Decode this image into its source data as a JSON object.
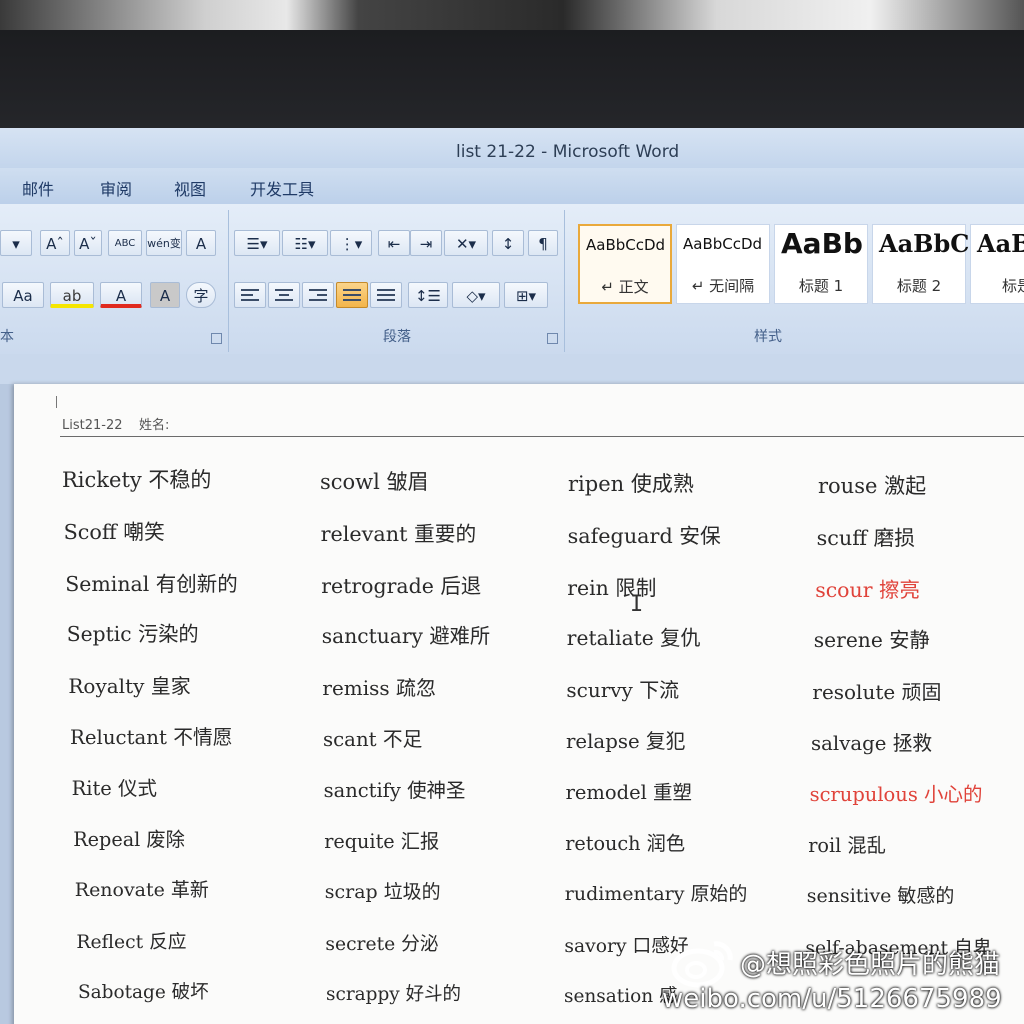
{
  "window": {
    "title": "list 21-22 - Microsoft Word"
  },
  "ribbon_tabs": [
    "邮件",
    "审阅",
    "视图",
    "开发工具"
  ],
  "ribbon": {
    "font_group_label": "本",
    "paragraph_group_label": "段落",
    "styles_group_label": "样式",
    "font_buttons": {
      "grow": "Aˆ",
      "shrink": "Aˇ",
      "clear_format": "ABC",
      "phonetic": "wén变",
      "char_border": "A",
      "change_case": "Aa",
      "highlight": "ab",
      "font_color": "A",
      "char_shading": "A",
      "enclose": "字"
    },
    "styles": [
      {
        "sample": "AaBbCcDd",
        "name": "↵ 正文",
        "selected": true
      },
      {
        "sample": "AaBbCcDd",
        "name": "↵ 无间隔",
        "selected": false
      },
      {
        "sample": "AaBb",
        "name": "标题 1",
        "selected": false
      },
      {
        "sample": "AaBbC",
        "name": "标题 2",
        "selected": false
      },
      {
        "sample": "AaB",
        "name": "标是",
        "selected": false
      }
    ]
  },
  "document": {
    "header": "List21-22    姓名:",
    "columns": [
      [
        "Rickety 不稳的",
        "Scoff 嘲笑",
        "Seminal 有创新的",
        "Septic 污染的",
        "Royalty 皇家",
        "Reluctant 不情愿",
        "Rite 仪式",
        "Repeal 废除",
        "Renovate 革新",
        "Reflect 反应",
        "Sabotage 破坏"
      ],
      [
        "scowl 皱眉",
        "relevant 重要的",
        "retrograde 后退",
        "sanctuary 避难所",
        "remiss 疏忽",
        "scant 不足",
        "sanctify 使神圣",
        "requite 汇报",
        "scrap 垃圾的",
        "secrete 分泌",
        "scrappy 好斗的"
      ],
      [
        "ripen 使成熟",
        "safeguard 安保",
        "rein 限制",
        "retaliate 复仇",
        "scurvy 下流",
        "relapse 复犯",
        "remodel 重塑",
        "retouch 润色",
        "rudimentary 原始的",
        "savory 口感好",
        "sensation 感"
      ],
      [
        "rouse 激起",
        "scuff 磨损",
        "scour 擦亮",
        "serene 安静",
        "resolute 顽固",
        "salvage 拯救",
        "scrupulous 小心的",
        "roil 混乱",
        "sensitive 敏感的",
        "self-abasement 自卑",
        ""
      ]
    ],
    "highlighted_words": [
      "scour 擦亮",
      "scrupulous 小心的"
    ],
    "highlight_color": "#e0433a"
  },
  "watermark": {
    "handle": "@想照彩色照片的熊猫",
    "url": "weibo.com/u/5126675989"
  },
  "colors": {
    "ribbon": "#cbdaee",
    "page": "#fbfbfa",
    "selected_style": "#e9a93b"
  }
}
